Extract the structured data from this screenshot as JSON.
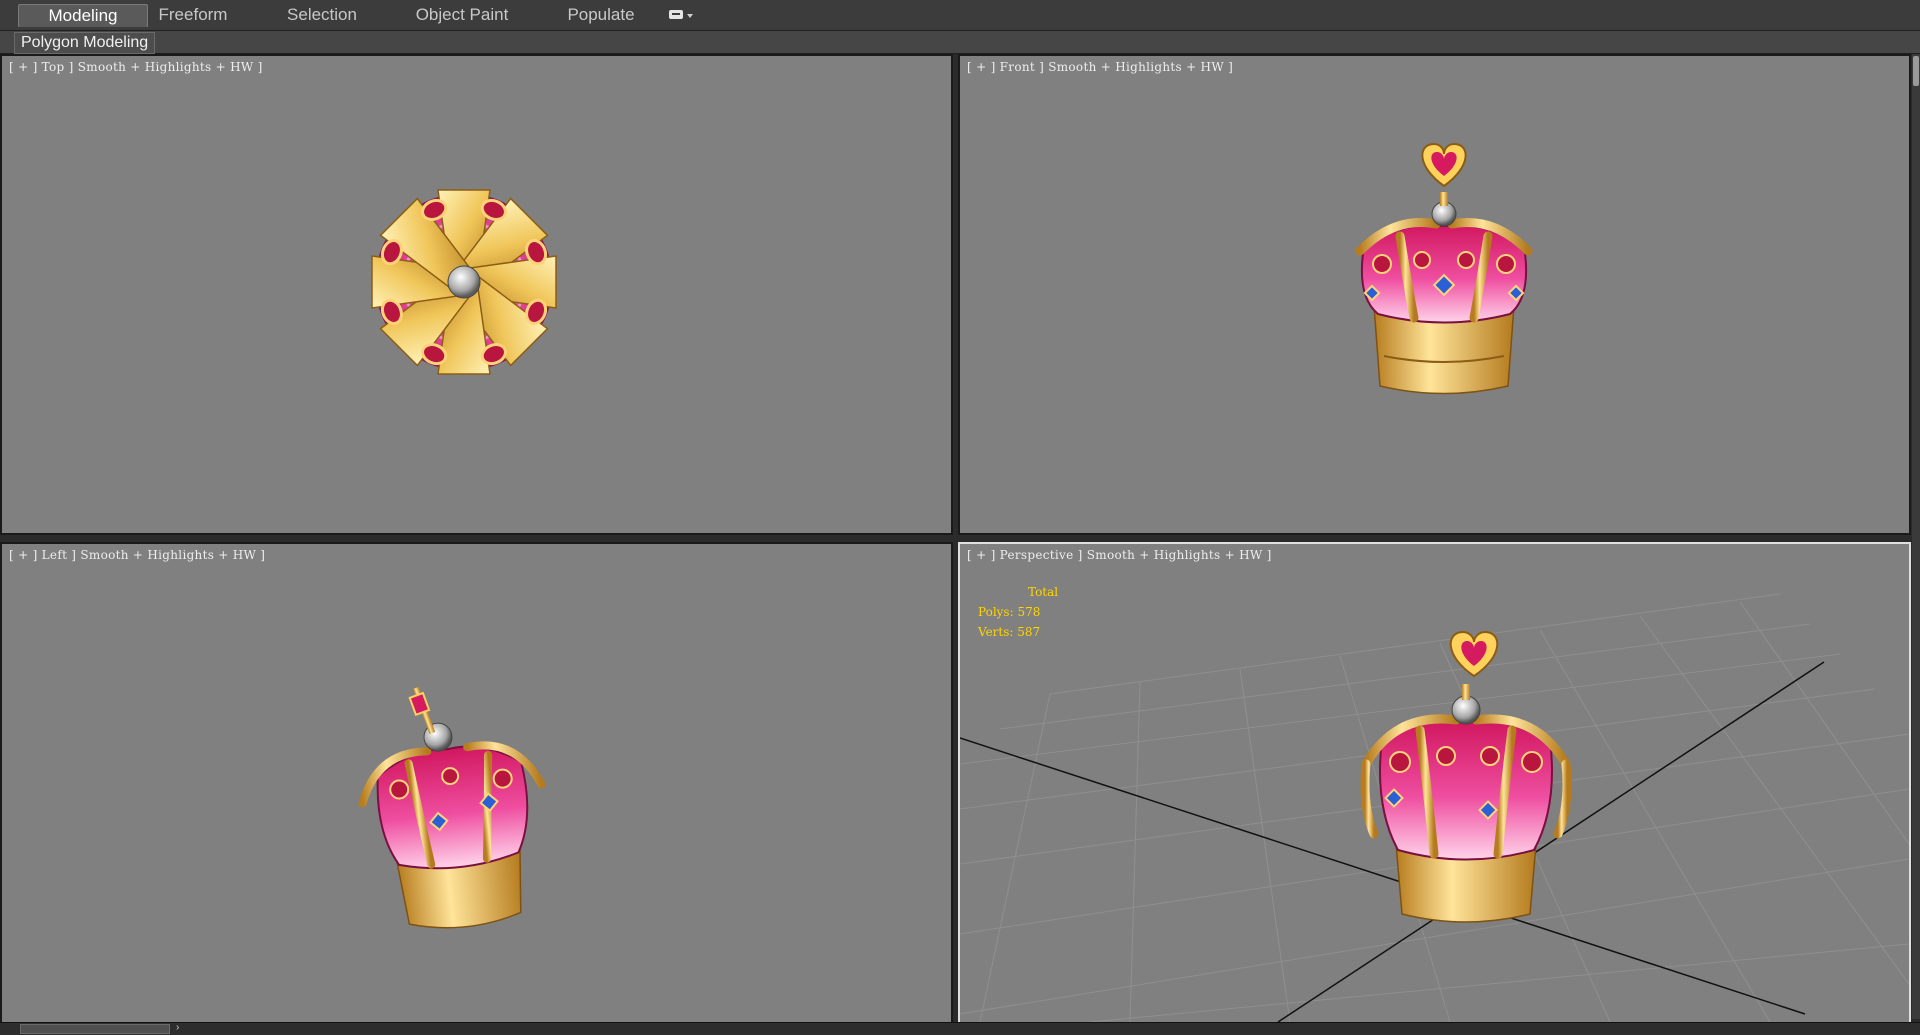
{
  "ribbon": {
    "tabs": [
      "Modeling",
      "Freeform",
      "Selection",
      "Object Paint",
      "Populate"
    ],
    "active_tab": "Modeling",
    "panel_label": "Polygon Modeling"
  },
  "viewports": {
    "top": {
      "label": "[ + ] Top ] Smooth + Highlights + HW ]"
    },
    "front": {
      "label": "[ + ] Front ] Smooth + Highlights + HW ]"
    },
    "left": {
      "label": "[ + ] Left ] Smooth + Highlights + HW ]"
    },
    "perspective": {
      "label": "[ + ] Perspective ] Smooth + Highlights + HW ]"
    }
  },
  "stats": {
    "header": "Total",
    "polys": "Polys: 578",
    "verts": "Verts: 587"
  },
  "colors": {
    "viewport_bg": "#808080",
    "stats_text": "#ffd400",
    "gold": "#e8b84a",
    "pink": "#e8398a",
    "ruby": "#b8163e",
    "sapphire": "#2b5fd6"
  },
  "icons": [
    "crown-model",
    "tab-options-icon",
    "time-next-icon"
  ]
}
